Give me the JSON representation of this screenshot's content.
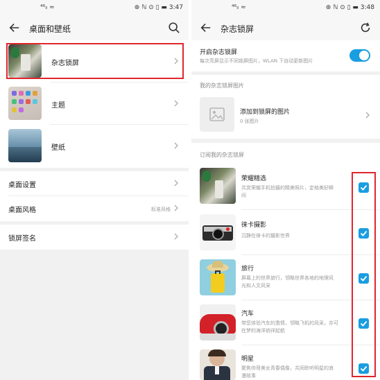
{
  "left": {
    "status": {
      "signal": "⁴⁶ₗₗ ≈",
      "right": "⊛ ℕ ⊙ ▯ ▬ 3:47"
    },
    "title": "桌面和壁纸",
    "items": [
      {
        "label": "杂志锁屏"
      },
      {
        "label": "主题"
      },
      {
        "label": "壁纸"
      }
    ],
    "settings": [
      {
        "label": "桌面设置",
        "value": ""
      },
      {
        "label": "桌面风格",
        "value": "标准风格"
      }
    ],
    "lockscreen_signature": "锁屏签名"
  },
  "right": {
    "status": {
      "signal": "⁴⁶ₗₗ ≈",
      "right": "⊛ ℕ ⊙ ▯ ▬ 3:48"
    },
    "title": "杂志锁屏",
    "enable": {
      "label": "开启杂志锁屏",
      "desc": "每次亮屏显示不同锁屏图片，WLAN 下自动更新图片",
      "on": true
    },
    "my_section": "我的杂志锁屏图片",
    "add": {
      "label": "添加到锁屏的图片",
      "count": "0 张图片"
    },
    "sub_section": "订阅我的杂志锁屏",
    "subscriptions": [
      {
        "label": "荣耀精选",
        "desc1": "共赏荣耀手机拍摄的精美照片，定格美好瞬",
        "desc2": "间",
        "checked": true
      },
      {
        "label": "徕卡摄影",
        "desc1": "沉静在徕卡的摄影世界",
        "desc2": "",
        "checked": true
      },
      {
        "label": "旅行",
        "desc1": "屏幕上的世界旅行，领略世界各地的地理风",
        "desc2": "光和人文风采",
        "checked": true
      },
      {
        "label": "汽车",
        "desc1": "带您体验汽车的激情，领略飞机的风采，亦可",
        "desc2": "在梦的海洋徜徉起航",
        "checked": true
      },
      {
        "label": "明星",
        "desc1": "聚焦帅哥美女青春偶像，共同聆听明星的浪",
        "desc2": "漫故事",
        "checked": true
      }
    ]
  },
  "colors": {
    "accent": "#1a9ee0",
    "highlight": "#e0262b"
  },
  "icons": [
    "back-arrow-icon",
    "search-icon",
    "refresh-icon",
    "chevron-right-icon",
    "image-placeholder-icon",
    "checkmark-icon"
  ]
}
